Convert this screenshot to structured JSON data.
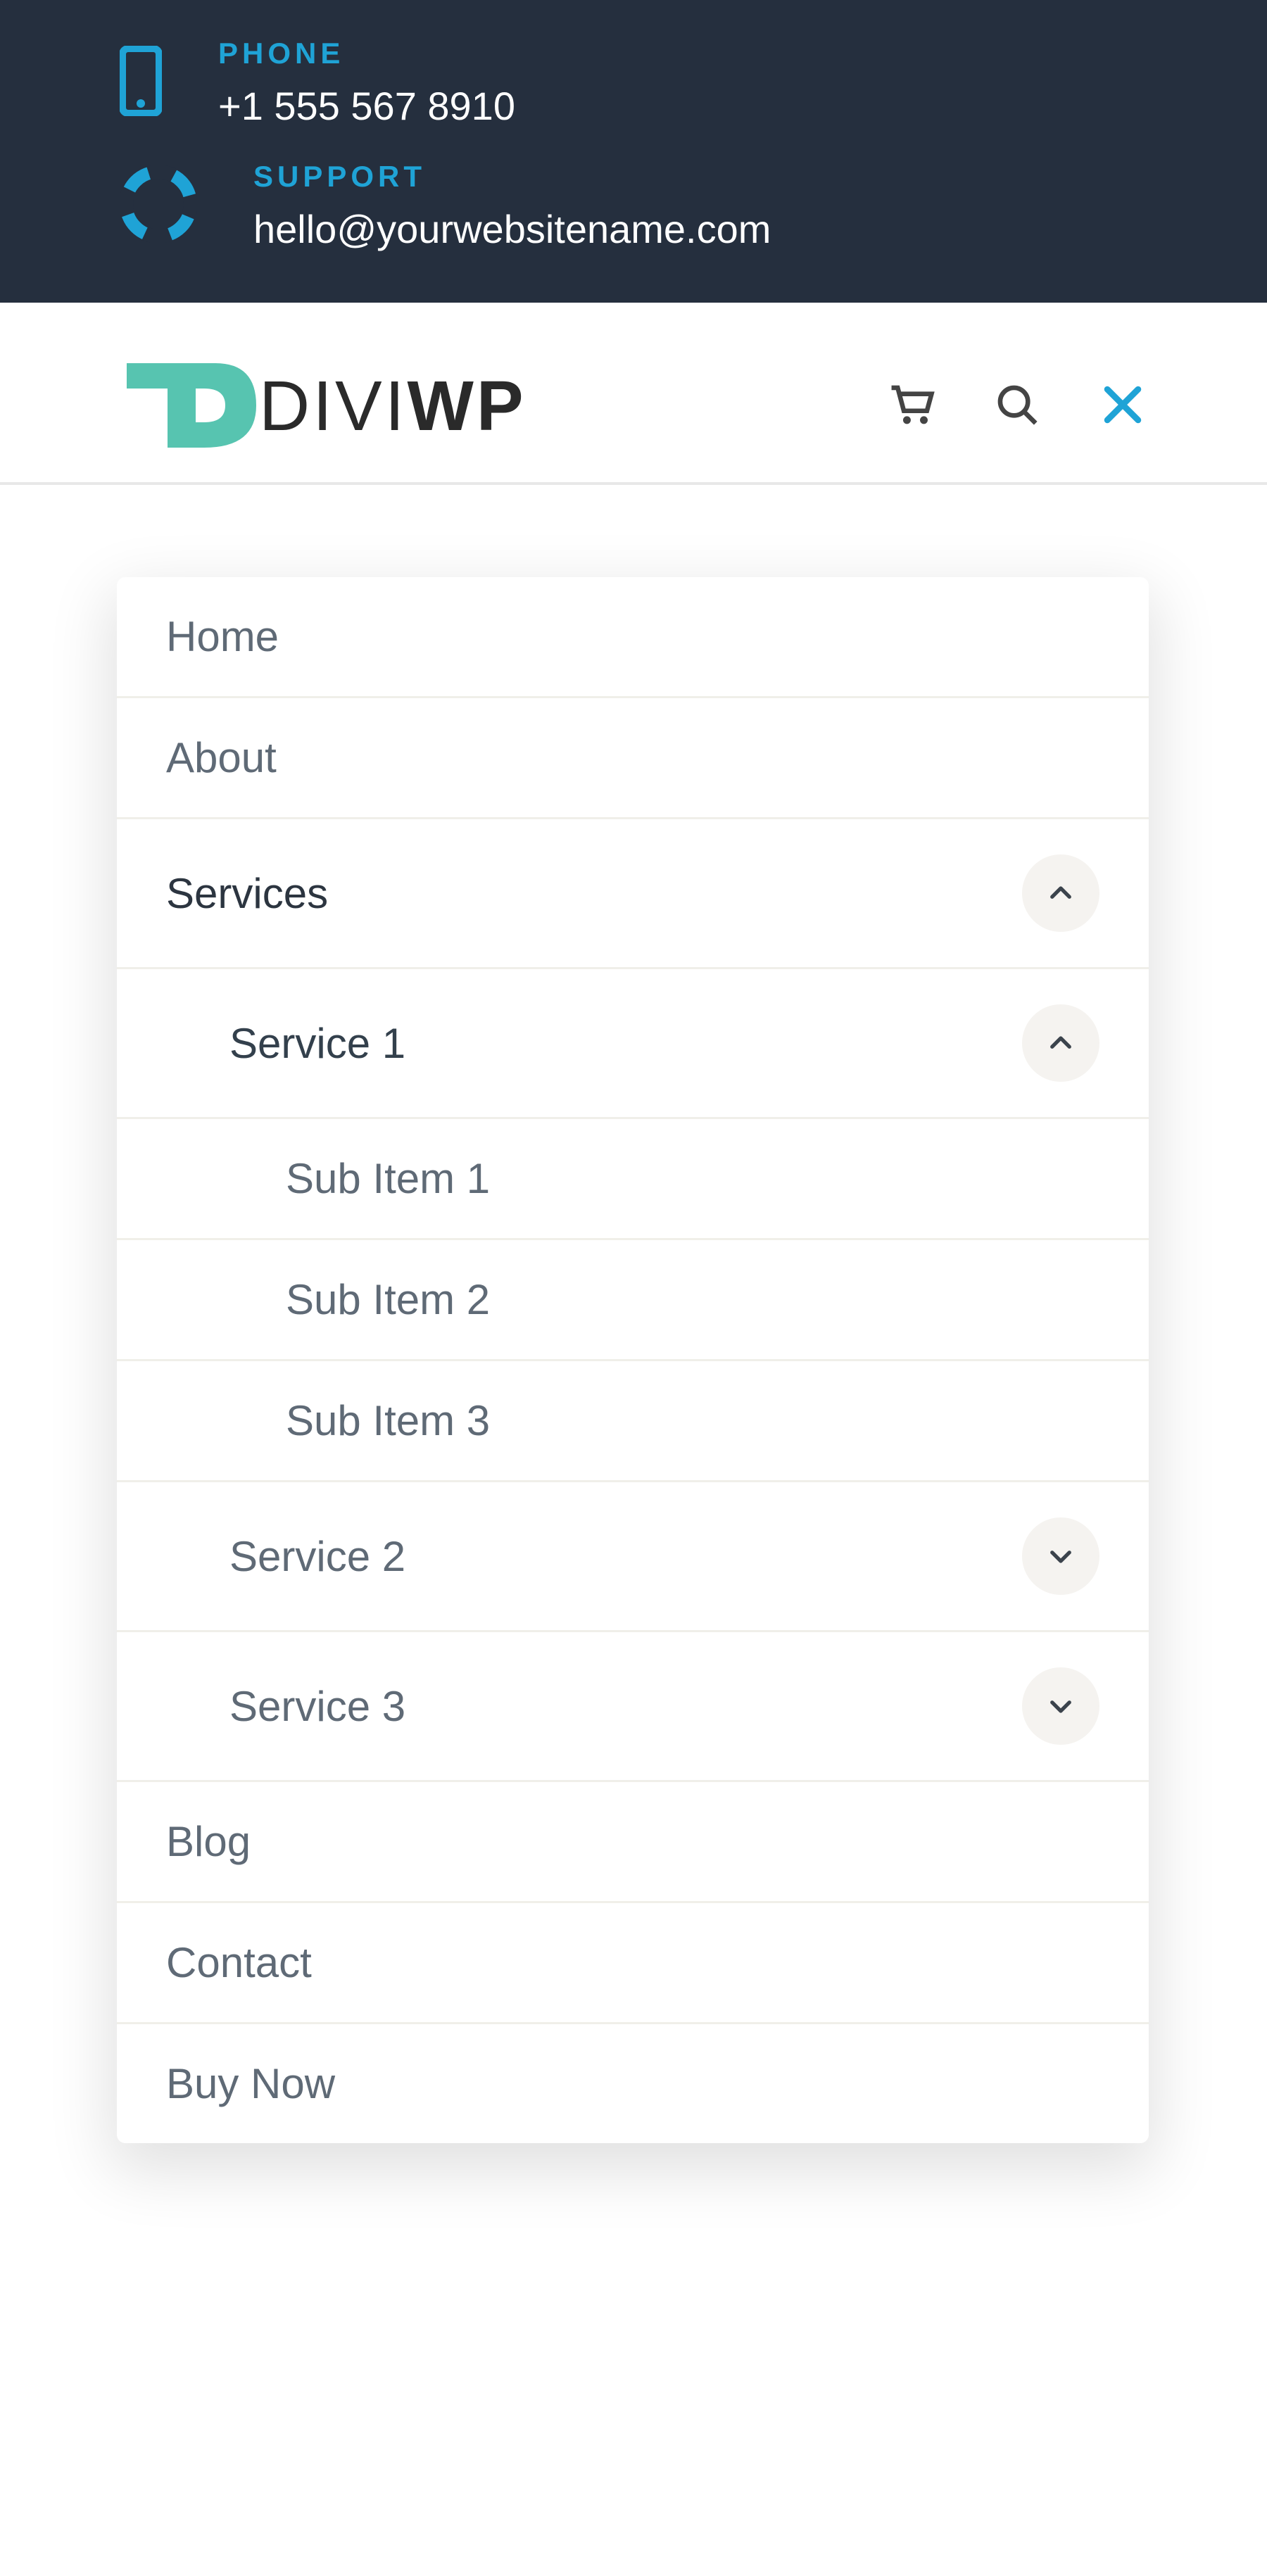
{
  "topbar": {
    "phone": {
      "label": "PHONE",
      "value": "+1 555 567 8910"
    },
    "support": {
      "label": "SUPPORT",
      "value": "hello@yourwebsitename.com"
    }
  },
  "logo": {
    "prefix": "DIVI",
    "suffix": "WP"
  },
  "menu": {
    "home": "Home",
    "about": "About",
    "services": "Services",
    "service1": "Service 1",
    "sub1": "Sub Item 1",
    "sub2": "Sub Item 2",
    "sub3": "Sub Item 3",
    "service2": "Service 2",
    "service3": "Service 3",
    "blog": "Blog",
    "contact": "Contact",
    "buy": "Buy Now"
  }
}
